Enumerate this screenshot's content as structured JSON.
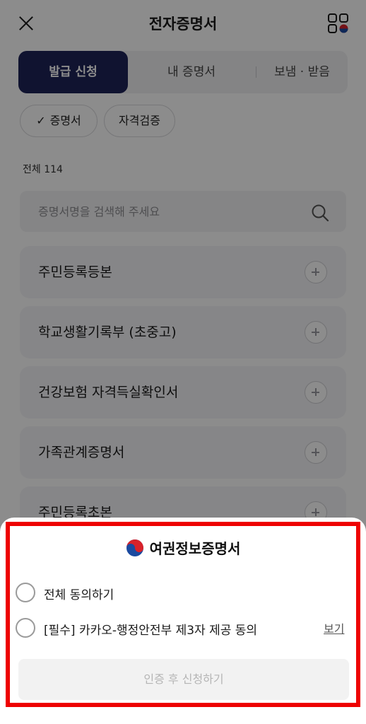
{
  "header": {
    "title": "전자증명서",
    "close_icon": "close-icon",
    "menu_icon": "grid-menu-icon"
  },
  "tabs": [
    {
      "label": "발급 신청",
      "active": true
    },
    {
      "label": "내 증명서",
      "active": false
    },
    {
      "label": "보냄 · 받음",
      "active": false
    }
  ],
  "filters": [
    {
      "label": "증명서",
      "selected": true,
      "icon": "check-icon"
    },
    {
      "label": "자격검증",
      "selected": false
    }
  ],
  "count_label": "전체 114",
  "search": {
    "placeholder": "증명서명을 검색해 주세요",
    "value": "",
    "icon": "search-icon"
  },
  "documents": [
    {
      "label": "주민등록등본"
    },
    {
      "label": "학교생활기록부 (초중고)"
    },
    {
      "label": "건강보험 자격득실확인서"
    },
    {
      "label": "가족관계증명서"
    },
    {
      "label": "주민등록초본"
    }
  ],
  "sheet": {
    "title": "여권정보증명서",
    "emblem_icon": "government-emblem-icon",
    "agree_all": {
      "label": "전체 동의하기",
      "checked": false
    },
    "agree_required": {
      "label": "[필수] 카카오-행정안전부 제3자 제공 동의",
      "checked": false,
      "link_label": "보기"
    },
    "submit": {
      "label": "인증 후 신청하기",
      "enabled": false
    }
  },
  "colors": {
    "primary": "#1e2358",
    "highlight": "#ee0000",
    "overlay": "rgba(0,0,0,0.45)"
  }
}
